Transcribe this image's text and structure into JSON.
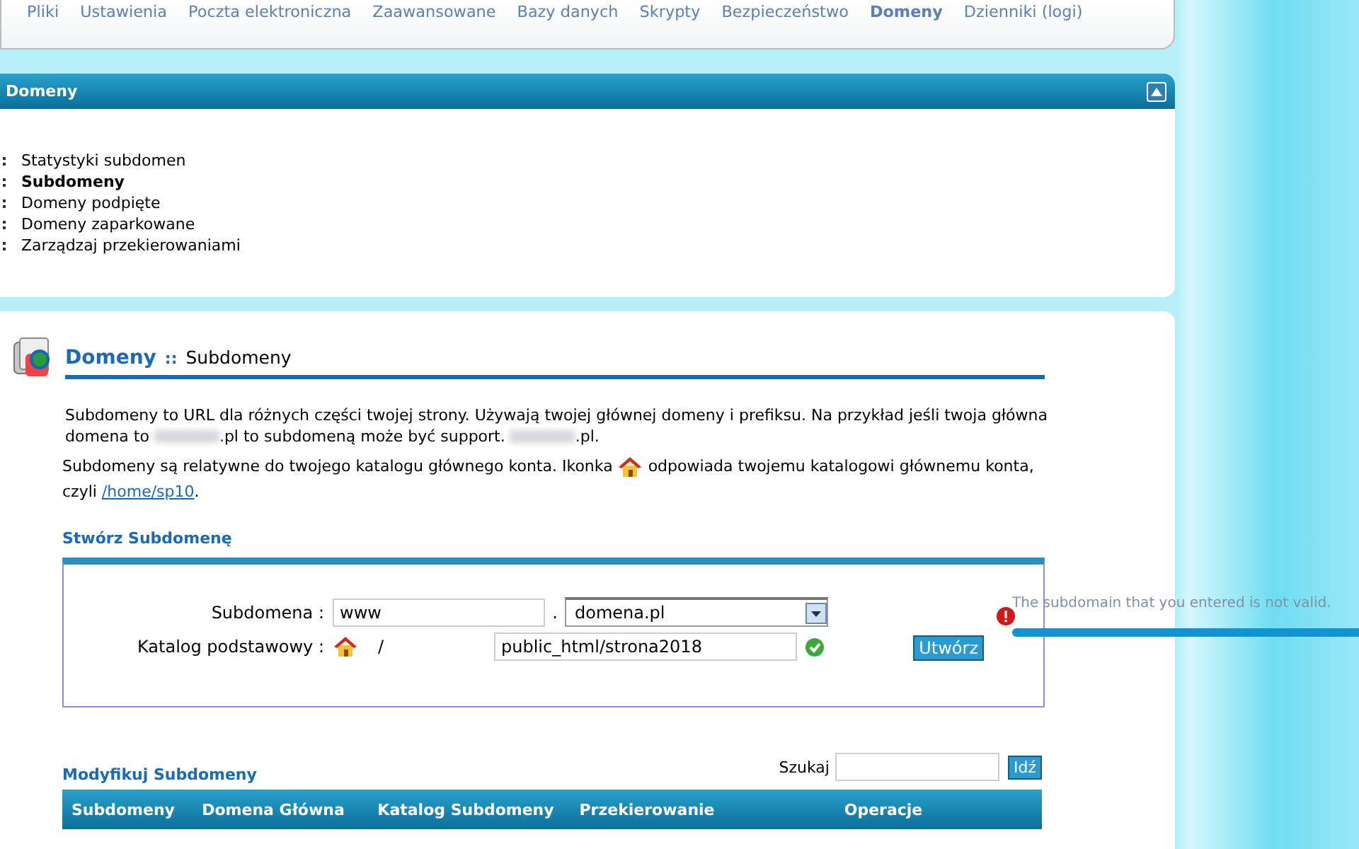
{
  "nav": [
    {
      "label": "Pliki",
      "selected": false
    },
    {
      "label": "Ustawienia",
      "selected": false
    },
    {
      "label": "Poczta elektroniczna",
      "selected": false
    },
    {
      "label": "Zaawansowane",
      "selected": false
    },
    {
      "label": "Bazy danych",
      "selected": false
    },
    {
      "label": "Skrypty",
      "selected": false
    },
    {
      "label": "Bezpieczeństwo",
      "selected": false
    },
    {
      "label": "Domeny",
      "selected": true
    },
    {
      "label": "Dzienniki (logi)",
      "selected": false
    }
  ],
  "panel": {
    "title": "Domeny",
    "items": [
      {
        "label": "Statystyki subdomen",
        "selected": false
      },
      {
        "label": "Subdomeny",
        "selected": true
      },
      {
        "label": "Domeny podpięte",
        "selected": false
      },
      {
        "label": "Domeny zaparkowane",
        "selected": false
      },
      {
        "label": "Zarządzaj przekierowaniami",
        "selected": false
      }
    ]
  },
  "heading": {
    "section": "Domeny",
    "separator": "::",
    "page": "Subdomeny"
  },
  "intro": [
    "Subdomeny to URL dla różnych części twojej strony. Używają twojej głównej domeny i prefiksu. Na przykład jeśli twoja główna domena to ",
    ".pl to subdomeną może być support. ",
    ".pl."
  ],
  "note": {
    "before": "Subdomeny są relatywne do twojego katalogu głównego konta. Ikonka",
    "after": "odpowiada twojemu katalogowi głównemu konta, czyli",
    "link": "/home/sp10",
    "end": "."
  },
  "create": {
    "title": "Stwórz Subdomenę",
    "subdomain_label": "Subdomena :",
    "subdomain_value": "www",
    "dot": ".",
    "domain_value": "domena.pl",
    "dir_label": "Katalog podstawowy :",
    "slash": "/",
    "dir_value": "public_html/strona2018",
    "dir_valid": true,
    "button": "Utwórz",
    "error": "The subdomain that you entered is not valid."
  },
  "modify": {
    "title": "Modyfikuj Subdomeny",
    "search_label": "Szukaj",
    "search_button": "Idź",
    "columns": [
      "Subdomeny",
      "Domena Główna",
      "Katalog Subdomeny",
      "Przekierowanie",
      "Operacje"
    ]
  }
}
